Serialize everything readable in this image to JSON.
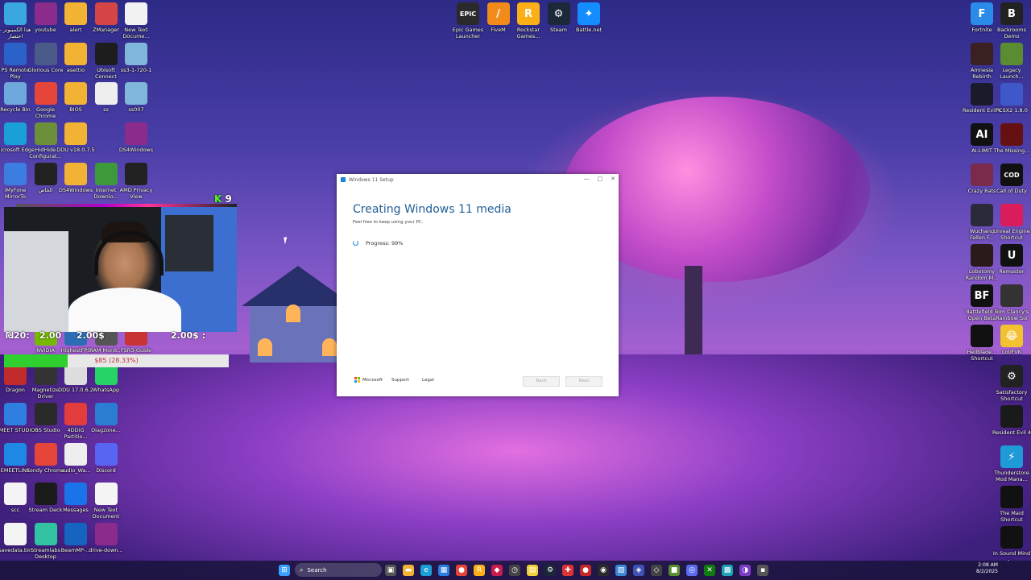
{
  "colors": {
    "accent": "#1e86d6",
    "goal_fill": "#2fcf2f",
    "kick_green": "#53fc18"
  },
  "desktop_icons_left": [
    {
      "label": "هذا الكمبيوتر - اختصار",
      "icon": "computer-icon",
      "color": "#3aa7e0",
      "col": 0,
      "row": 0
    },
    {
      "label": "youtube",
      "icon": "winrar-icon",
      "color": "#8b2b8b",
      "col": 1,
      "row": 0
    },
    {
      "label": "alert",
      "icon": "folder-icon",
      "color": "#f2b233",
      "col": 2,
      "row": 0
    },
    {
      "label": "ZManager",
      "icon": "zmanager-icon",
      "color": "#d64545",
      "col": 3,
      "row": 0
    },
    {
      "label": "New Text Docume...",
      "icon": "text-document-icon",
      "color": "#f2f2f2",
      "col": 4,
      "row": 0
    },
    {
      "label": "PS Remote Play",
      "icon": "ps-remote-icon",
      "color": "#2a62c9",
      "col": 0,
      "row": 1
    },
    {
      "label": "Glorious Core",
      "icon": "glorious-icon",
      "color": "#4a5b8a",
      "col": 1,
      "row": 1
    },
    {
      "label": "asettio",
      "icon": "folder-icon",
      "color": "#f2b233",
      "col": 2,
      "row": 1
    },
    {
      "label": "Ubisoft Connect",
      "icon": "ubisoft-icon",
      "color": "#1d1d1d",
      "col": 3,
      "row": 1
    },
    {
      "label": "ss3-1-720-1",
      "icon": "image-icon",
      "color": "#7fb6d9",
      "col": 4,
      "row": 1
    },
    {
      "label": "Recycle Bin",
      "icon": "recycle-bin-icon",
      "color": "#6fa8dc",
      "col": 0,
      "row": 2
    },
    {
      "label": "Google Chrome",
      "icon": "chrome-icon",
      "color": "#e6453a",
      "col": 1,
      "row": 2
    },
    {
      "label": "BIOS",
      "icon": "folder-icon",
      "color": "#f2b233",
      "col": 2,
      "row": 2
    },
    {
      "label": "ss",
      "icon": "video-file-icon",
      "color": "#eeeeee",
      "col": 3,
      "row": 2
    },
    {
      "label": "ss007",
      "icon": "image-icon",
      "color": "#7fb6d9",
      "col": 4,
      "row": 2
    },
    {
      "label": "Microsoft Edge",
      "icon": "edge-icon",
      "color": "#1a9fd6",
      "col": 0,
      "row": 3
    },
    {
      "label": "HidHide Configurat...",
      "icon": "hidhide-icon",
      "color": "#6c8f3a",
      "col": 1,
      "row": 3
    },
    {
      "label": "DDU v18.0.7.5",
      "icon": "folder-icon",
      "color": "#f2b233",
      "col": 2,
      "row": 3
    },
    {
      "label": "DS4Windows",
      "icon": "winrar-icon",
      "color": "#8b2b8b",
      "col": 4,
      "row": 3
    },
    {
      "label": "iMyFone MirrorTo",
      "icon": "imyfone-icon",
      "color": "#3b7de0",
      "col": 0,
      "row": 4
    },
    {
      "label": "الخاص",
      "icon": "folder-icon",
      "color": "#222222",
      "col": 1,
      "row": 4
    },
    {
      "label": "DS4Windows",
      "icon": "folder-icon",
      "color": "#f2b233",
      "col": 2,
      "row": 4
    },
    {
      "label": "Internet Downlo...",
      "icon": "idm-icon",
      "color": "#3c9a3c",
      "col": 3,
      "row": 4
    },
    {
      "label": "AMD Privacy View",
      "icon": "amd-icon",
      "color": "#222222",
      "col": 4,
      "row": 4
    },
    {
      "label": "NVIDIA Broadcast",
      "icon": "nvidia-icon",
      "color": "#76b900",
      "col": 1,
      "row": 8
    },
    {
      "label": "HighestFPS",
      "icon": "fps-icon",
      "color": "#2b6db5",
      "col": 2,
      "row": 8
    },
    {
      "label": "RAM Monit...",
      "icon": "ram-icon",
      "color": "#555555",
      "col": 3,
      "row": 8
    },
    {
      "label": "FSR3-Guide",
      "icon": "guide-icon",
      "color": "#c83434",
      "col": 4,
      "row": 8
    },
    {
      "label": "Dragon",
      "icon": "dragon-icon",
      "color": "#c22b2b",
      "col": 0,
      "row": 9
    },
    {
      "label": "Magnetize Driver",
      "icon": "magnetize-icon",
      "color": "#333333",
      "col": 1,
      "row": 9
    },
    {
      "label": "DDU 17.0.6.2",
      "icon": "ddu-icon",
      "color": "#dddddd",
      "col": 2,
      "row": 9
    },
    {
      "label": "WhatsApp",
      "icon": "whatsapp-icon",
      "color": "#25d366",
      "col": 3,
      "row": 9
    },
    {
      "label": "EMEET STUDIO",
      "icon": "emeet-icon",
      "color": "#2f7fe0",
      "col": 0,
      "row": 10
    },
    {
      "label": "OBS Studio",
      "icon": "obs-icon",
      "color": "#2a2a2a",
      "col": 1,
      "row": 10
    },
    {
      "label": "4DDiG Partitio...",
      "icon": "4ddig-icon",
      "color": "#e23c3c",
      "col": 2,
      "row": 10
    },
    {
      "label": "Diagzone...",
      "icon": "diagzone-icon",
      "color": "#2b7cd3",
      "col": 3,
      "row": 10
    },
    {
      "label": "EMEETLINK",
      "icon": "emeetlink-icon",
      "color": "#1e88e5",
      "col": 0,
      "row": 11
    },
    {
      "label": "Sondy Chrome",
      "icon": "chrome-icon",
      "color": "#e6453a",
      "col": 1,
      "row": 11
    },
    {
      "label": "audio_Wa...",
      "icon": "audio-file-icon",
      "color": "#eeeeee",
      "col": 2,
      "row": 11
    },
    {
      "label": "Discord",
      "icon": "discord-icon",
      "color": "#5865f2",
      "col": 3,
      "row": 11
    },
    {
      "label": "scc",
      "icon": "blank-file-icon",
      "color": "#f4f4f4",
      "col": 0,
      "row": 12
    },
    {
      "label": "Stream Deck",
      "icon": "stream-deck-icon",
      "color": "#1b1b1b",
      "col": 1,
      "row": 12
    },
    {
      "label": "Messages",
      "icon": "messages-icon",
      "color": "#1a73e8",
      "col": 2,
      "row": 12
    },
    {
      "label": "New Text Document",
      "icon": "text-document-icon",
      "color": "#f4f4f4",
      "col": 3,
      "row": 12
    },
    {
      "label": "savedata.bin",
      "icon": "blank-file-icon",
      "color": "#f4f4f4",
      "col": 0,
      "row": 13
    },
    {
      "label": "Streamlabs Desktop",
      "icon": "streamlabs-icon",
      "color": "#31c3a2",
      "col": 1,
      "row": 13
    },
    {
      "label": "BeamMP-...",
      "icon": "beammp-icon",
      "color": "#1565c0",
      "col": 2,
      "row": 13
    },
    {
      "label": "drive-down...",
      "icon": "winrar-icon",
      "color": "#8b2b8b",
      "col": 3,
      "row": 13
    }
  ],
  "desktop_icons_top": [
    {
      "label": "Epic Games Launcher",
      "icon": "epic-games-icon",
      "color": "#2a2a2a",
      "glyph": "EPIC"
    },
    {
      "label": "FiveM",
      "icon": "fivem-icon",
      "color": "#f28b1a",
      "glyph": "/"
    },
    {
      "label": "Rockstar Games...",
      "icon": "rockstar-icon",
      "color": "#fcaf17",
      "glyph": "R"
    },
    {
      "label": "Steam",
      "icon": "steam-icon",
      "color": "#1b2838",
      "glyph": "⚙"
    },
    {
      "label": "Battle.net",
      "icon": "battlenet-icon",
      "color": "#148eff",
      "glyph": "✦"
    }
  ],
  "desktop_icons_right": [
    {
      "label": "Fortnite",
      "icon": "fortnite-icon",
      "color": "#2b8be8",
      "glyph": "F",
      "col": 0,
      "row": 0
    },
    {
      "label": "Backrooms Demo",
      "icon": "backrooms-icon",
      "color": "#222222",
      "glyph": "B",
      "col": 1,
      "row": 0
    },
    {
      "label": "Amnesia Rebirth",
      "icon": "amnesia-icon",
      "color": "#3a2020",
      "glyph": "",
      "col": 0,
      "row": 1
    },
    {
      "label": "Legacy Launch...",
      "icon": "minecraft-icon",
      "color": "#5b8c32",
      "glyph": "",
      "col": 1,
      "row": 1
    },
    {
      "label": "Resident Evil 6",
      "icon": "resident-evil-icon",
      "color": "#1a1a2a",
      "glyph": "",
      "col": 0,
      "row": 2
    },
    {
      "label": "PCSX2 1.8.0",
      "icon": "pcsx2-icon",
      "color": "#3f58c9",
      "glyph": "",
      "col": 1,
      "row": 2
    },
    {
      "label": "AI-LIMIT",
      "icon": "ai-limit-icon",
      "color": "#111111",
      "glyph": "AI",
      "col": 0,
      "row": 3
    },
    {
      "label": "The Missing...",
      "icon": "the-missing-icon",
      "color": "#661111",
      "glyph": "",
      "col": 1,
      "row": 3
    },
    {
      "label": "Crazy Rats",
      "icon": "crazy-rats-icon",
      "color": "#7a2a4a",
      "glyph": "",
      "col": 0,
      "row": 4
    },
    {
      "label": "Call of Duty",
      "icon": "call-of-duty-icon",
      "color": "#111111",
      "glyph": "COD",
      "col": 1,
      "row": 4
    },
    {
      "label": "Wuchang Fallen F...",
      "icon": "wuchang-icon",
      "color": "#2a2a3a",
      "glyph": "",
      "col": 0,
      "row": 5
    },
    {
      "label": "Unreal Engine Shortcut",
      "icon": "unreal-engine-icon",
      "color": "#d91c5c",
      "glyph": "",
      "col": 1,
      "row": 5
    },
    {
      "label": "Lobotomy Random M...",
      "icon": "lobotomy-icon",
      "color": "#2a1a1a",
      "glyph": "",
      "col": 0,
      "row": 6
    },
    {
      "label": "Remaster",
      "icon": "remaster-icon",
      "color": "#111111",
      "glyph": "U",
      "col": 1,
      "row": 6
    },
    {
      "label": "Battlefield 6 Open Beta",
      "icon": "battlefield-icon",
      "color": "#111111",
      "glyph": "BF",
      "col": 0,
      "row": 7
    },
    {
      "label": "Tom Clancy's Rainbow Six",
      "icon": "rainbow-six-icon",
      "color": "#333333",
      "glyph": "",
      "col": 1,
      "row": 7
    },
    {
      "label": "Hellblade... Shortcut",
      "icon": "hellblade-icon",
      "color": "#111111",
      "glyph": "",
      "col": 0,
      "row": 8
    },
    {
      "label": "Lol/FVK",
      "icon": "emoji-laugh-icon",
      "color": "#f2c230",
      "glyph": "😂",
      "col": 1,
      "row": 8
    },
    {
      "label": "Satisfactory Shortcut",
      "icon": "satisfactory-icon",
      "color": "#222222",
      "glyph": "⚙",
      "col": 1,
      "row": 9
    },
    {
      "label": "Resident Evil 4",
      "icon": "resident-evil-4-icon",
      "color": "#1a1a1a",
      "glyph": "",
      "col": 1,
      "row": 10
    },
    {
      "label": "Thunderstore Mod Mana...",
      "icon": "thunderstore-icon",
      "color": "#1e9ad6",
      "glyph": "⚡",
      "col": 1,
      "row": 11
    },
    {
      "label": "The Maid Shortcut",
      "icon": "the-maid-icon",
      "color": "#111111",
      "glyph": "",
      "col": 1,
      "row": 12
    },
    {
      "label": "In Sound Mind - ...",
      "icon": "in-sound-mind-icon",
      "color": "#111111",
      "glyph": "",
      "col": 1,
      "row": 13
    }
  ],
  "stream_overlay": {
    "kick_count": "9",
    "donation_left": "₪20:",
    "donation_mid1": "2.00",
    "donation_mid2": "2.00$",
    "donation_right": "2.00$ :",
    "goal_text": "$85 (28.33%)",
    "goal_fraction": 0.2833
  },
  "setup_window": {
    "title": "Windows 11 Setup",
    "heading": "Creating Windows 11 media",
    "subtitle": "Feel free to keep using your PC.",
    "progress_label": "Progress: 99%",
    "brand": "Microsoft",
    "support_link": "Support",
    "legal_link": "Legal",
    "back_button": "Back",
    "next_button": "Next",
    "minimize": "—",
    "maximize": "□",
    "close": "✕"
  },
  "taskbar": {
    "search_placeholder": "Search",
    "time": "2:08 AM",
    "date": "8/2/2025",
    "apps": [
      {
        "name": "windows-start-icon",
        "color": "#3aa0ff",
        "glyph": "⊞"
      },
      {
        "name": "task-view-icon",
        "color": "#555555",
        "glyph": "▣"
      },
      {
        "name": "file-explorer-icon",
        "color": "#f2b233",
        "glyph": "▬"
      },
      {
        "name": "edge-icon",
        "color": "#1a9fd6",
        "glyph": "e"
      },
      {
        "name": "store-icon",
        "color": "#2a7de1",
        "glyph": "▦"
      },
      {
        "name": "chrome-icon",
        "color": "#e6453a",
        "glyph": "●"
      },
      {
        "name": "rockstar-icon",
        "color": "#fcaf17",
        "glyph": "R"
      },
      {
        "name": "app-icon",
        "color": "#c81b4f",
        "glyph": "◆"
      },
      {
        "name": "clock-icon",
        "color": "#444444",
        "glyph": "◷"
      },
      {
        "name": "notes-icon",
        "color": "#f2d03a",
        "glyph": "▤"
      },
      {
        "name": "steam-icon",
        "color": "#1b2838",
        "glyph": "⚙"
      },
      {
        "name": "antivirus-icon",
        "color": "#d33",
        "glyph": "✚"
      },
      {
        "name": "recorder-icon",
        "color": "#c62828",
        "glyph": "●"
      },
      {
        "name": "obs-icon",
        "color": "#2a2a2a",
        "glyph": "◉"
      },
      {
        "name": "photos-icon",
        "color": "#3e88d8",
        "glyph": "▨"
      },
      {
        "name": "vpn-icon",
        "color": "#3f51b5",
        "glyph": "◈"
      },
      {
        "name": "code-icon",
        "color": "#444",
        "glyph": "◇"
      },
      {
        "name": "minecraft-icon",
        "color": "#5b8c32",
        "glyph": "■"
      },
      {
        "name": "messenger-icon",
        "color": "#5b6cf0",
        "glyph": "◎"
      },
      {
        "name": "xbox-icon",
        "color": "#107c10",
        "glyph": "✕"
      },
      {
        "name": "app2-icon",
        "color": "#1ea2b8",
        "glyph": "▩"
      },
      {
        "name": "app3-icon",
        "color": "#7d3cc7",
        "glyph": "◑"
      },
      {
        "name": "app4-icon",
        "color": "#555",
        "glyph": "▪"
      }
    ]
  }
}
